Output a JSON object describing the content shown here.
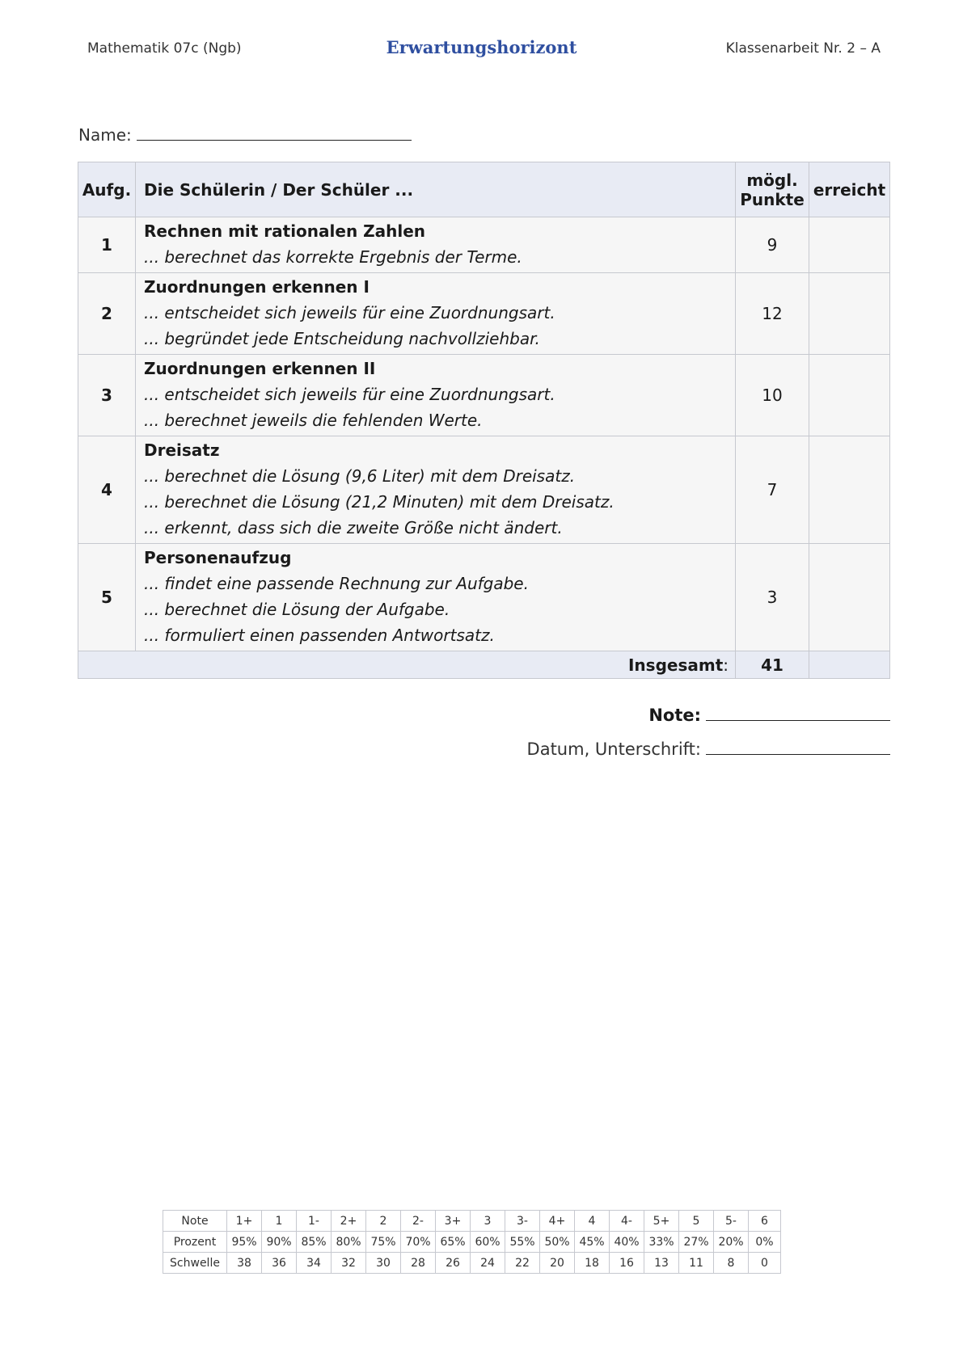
{
  "header": {
    "left": "Mathematik 07c (Ngb)",
    "title": "Erwartungshorizont",
    "right": "Klassenarbeit Nr. 2 – A"
  },
  "name_label": "Name:",
  "table": {
    "headers": {
      "task": "Aufg.",
      "description": "Die Schülerin / Der Schüler ...",
      "points_line1": "mögl.",
      "points_line2": "Punkte",
      "achieved": "erreicht"
    },
    "rows": [
      {
        "num": "1",
        "title": "Rechnen mit rationalen Zahlen",
        "criteria": [
          "... berechnet das korrekte Ergebnis der Terme."
        ],
        "points": "9"
      },
      {
        "num": "2",
        "title": "Zuordnungen erkennen I",
        "criteria": [
          "... entscheidet sich jeweils für eine Zuordnungsart.",
          "... begründet jede Entscheidung nachvollziehbar."
        ],
        "points": "12"
      },
      {
        "num": "3",
        "title": "Zuordnungen erkennen II",
        "criteria": [
          "... entscheidet sich jeweils für eine Zuordnungsart.",
          "... berechnet jeweils die fehlenden Werte."
        ],
        "points": "10"
      },
      {
        "num": "4",
        "title": "Dreisatz",
        "criteria": [
          "... berechnet die Lösung (9,6 Liter) mit dem Dreisatz.",
          "... berechnet die Lösung (21,2 Minuten) mit dem Dreisatz.",
          "... erkennt, dass sich die zweite Größe nicht ändert."
        ],
        "points": "7"
      },
      {
        "num": "5",
        "title": "Personenaufzug",
        "criteria": [
          "... findet eine passende Rechnung zur Aufgabe.",
          "... berechnet die Lösung der Aufgabe.",
          "... formuliert einen passenden Antwortsatz."
        ],
        "points": "3"
      }
    ],
    "total_label": "Insgesamt",
    "total_colon": ":",
    "total_points": "41"
  },
  "note_label": "Note:",
  "datum_label": "Datum, Unterschrift:",
  "grades": {
    "labels": [
      "Note",
      "Prozent",
      "Schwelle"
    ],
    "note": [
      "1+",
      "1",
      "1-",
      "2+",
      "2",
      "2-",
      "3+",
      "3",
      "3-",
      "4+",
      "4",
      "4-",
      "5+",
      "5",
      "5-",
      "6"
    ],
    "prozent": [
      "95%",
      "90%",
      "85%",
      "80%",
      "75%",
      "70%",
      "65%",
      "60%",
      "55%",
      "50%",
      "45%",
      "40%",
      "33%",
      "27%",
      "20%",
      "0%"
    ],
    "schwelle": [
      "38",
      "36",
      "34",
      "32",
      "30",
      "28",
      "26",
      "24",
      "22",
      "20",
      "18",
      "16",
      "13",
      "11",
      "8",
      "0"
    ]
  }
}
